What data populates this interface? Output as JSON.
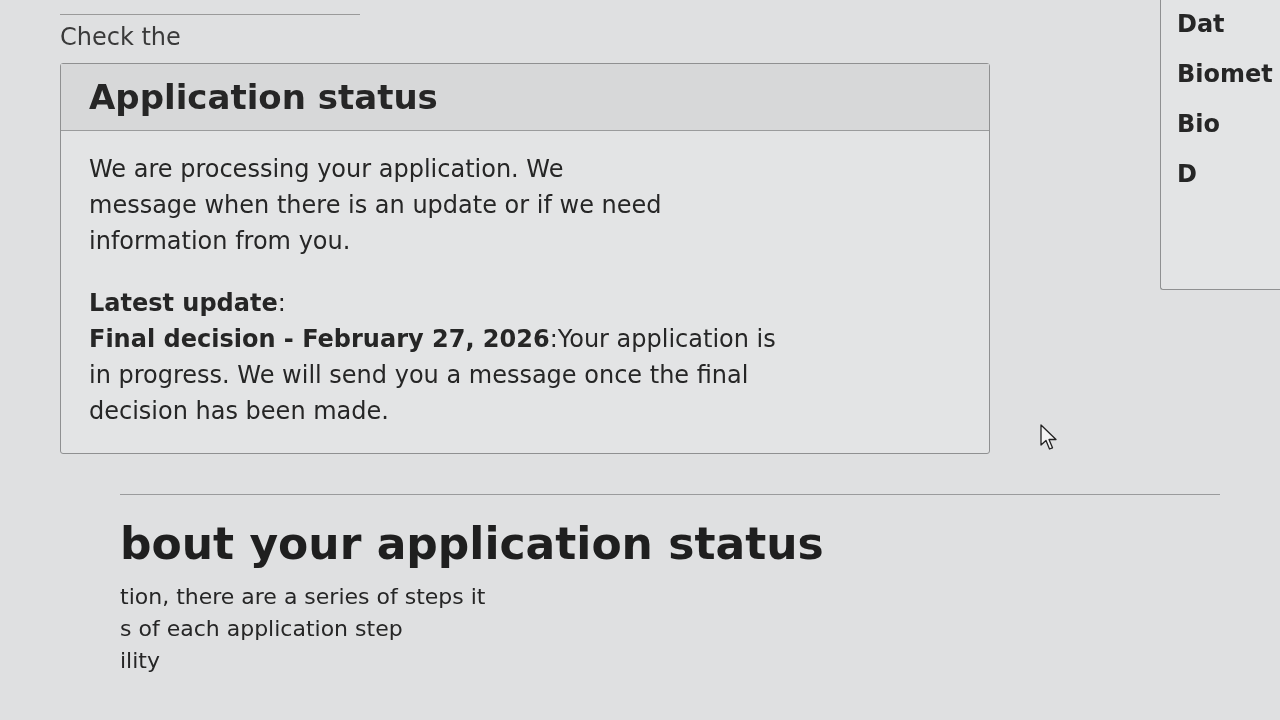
{
  "intro": {
    "text": "Check the"
  },
  "status_card": {
    "title": "Application status",
    "message_lines": [
      "We are processing your application. We",
      "message when there is an update or if we need",
      "information from you."
    ],
    "latest_label": "**Latest update**:",
    "latest_text": "**Final decision - February 27, 2026**:Your application is in progress. We will send you a message once the final decision has been made."
  },
  "side_card": {
    "labels": [
      "Dat",
      "Biomet",
      "Bio",
      "D"
    ]
  },
  "about_section": {
    "heading": "bout your application status",
    "lines": [
      "tion, there are a series of steps it",
      "s of each application step",
      "ility"
    ]
  }
}
